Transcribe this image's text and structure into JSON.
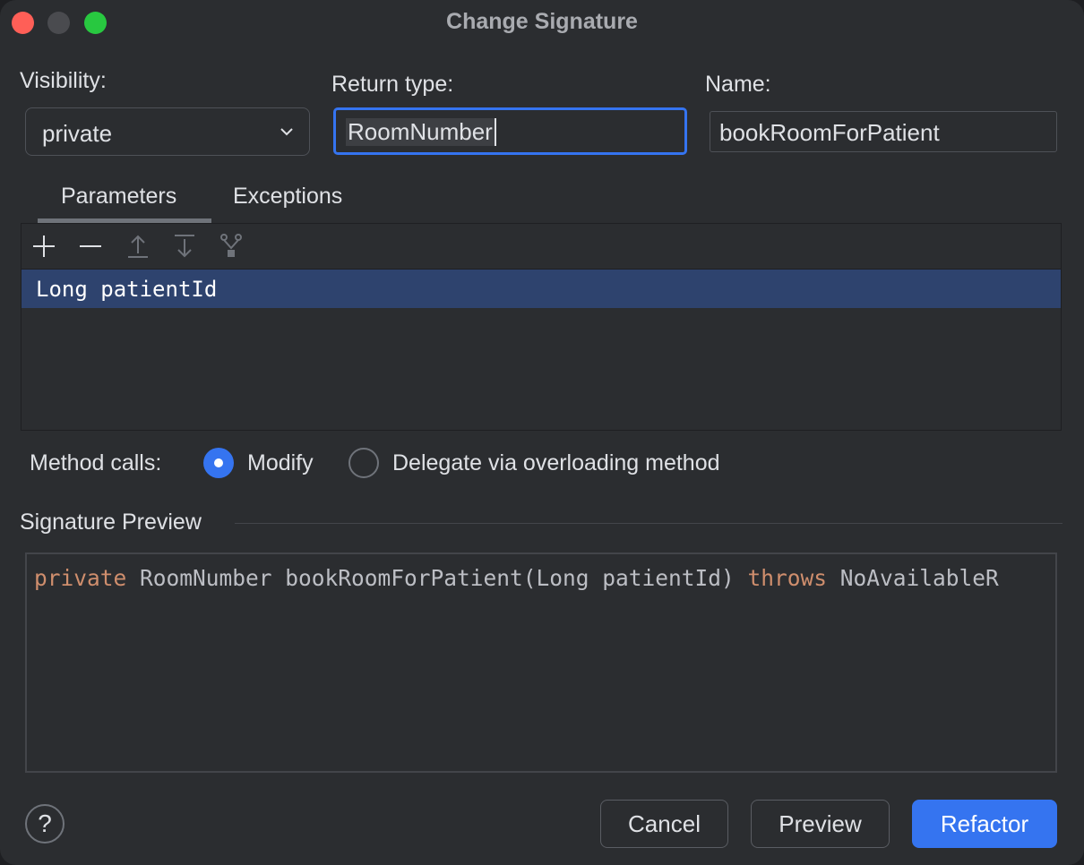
{
  "window": {
    "title": "Change Signature"
  },
  "visibility": {
    "label": "Visibility:",
    "value": "private"
  },
  "return_type": {
    "label": "Return type:",
    "value": "RoomNumber"
  },
  "name": {
    "label": "Name:",
    "value": "bookRoomForPatient"
  },
  "tabs": [
    {
      "label": "Parameters",
      "selected": true
    },
    {
      "label": "Exceptions",
      "selected": false
    }
  ],
  "toolbar": {
    "icons": [
      "add-icon",
      "remove-icon",
      "move-up-icon",
      "move-down-icon",
      "propagate-icon"
    ]
  },
  "parameters": [
    {
      "text": "Long patientId",
      "selected": true
    }
  ],
  "method_calls": {
    "label": "Method calls:",
    "options": [
      {
        "label": "Modify",
        "checked": true
      },
      {
        "label": "Delegate via overloading method",
        "checked": false
      }
    ]
  },
  "signature_preview": {
    "heading": "Signature Preview",
    "tokens": {
      "modifier": "private",
      "body": " RoomNumber bookRoomForPatient(Long patientId) ",
      "throws": "throws",
      "tail": " NoAvailableR"
    }
  },
  "buttons": {
    "help": "?",
    "cancel": "Cancel",
    "preview": "Preview",
    "refactor": "Refactor"
  },
  "colors": {
    "accent": "#3574f0",
    "keyword": "#cf8e6d",
    "selection": "#2e436e",
    "background": "#2b2d30"
  }
}
